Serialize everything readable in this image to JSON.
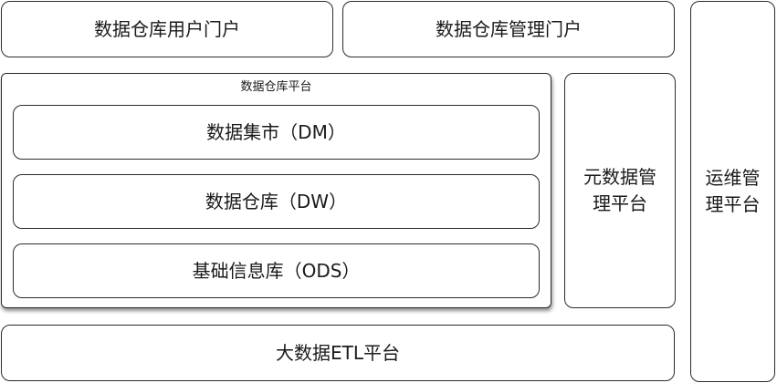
{
  "top": {
    "user_portal": "数据仓库用户门户",
    "admin_portal": "数据仓库管理门户"
  },
  "warehouse_platform": {
    "title": "数据仓库平台",
    "layers": [
      "数据集市（DM）",
      "数据仓库（DW）",
      "基础信息库（ODS）"
    ]
  },
  "metadata_platform": "元数据管理平台",
  "ops_platform": "运维管理平台",
  "etl_platform": "大数据ETL平台"
}
